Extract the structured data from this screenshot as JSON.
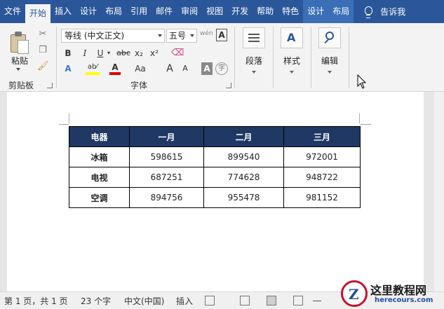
{
  "tabs": [
    {
      "label": "文件",
      "state": "normal"
    },
    {
      "label": "开始",
      "state": "active"
    },
    {
      "label": "插入",
      "state": "normal"
    },
    {
      "label": "设计",
      "state": "normal"
    },
    {
      "label": "布局",
      "state": "normal"
    },
    {
      "label": "引用",
      "state": "normal"
    },
    {
      "label": "邮件",
      "state": "normal"
    },
    {
      "label": "审阅",
      "state": "normal"
    },
    {
      "label": "视图",
      "state": "normal"
    },
    {
      "label": "开发",
      "state": "normal"
    },
    {
      "label": "帮助",
      "state": "normal"
    },
    {
      "label": "特色",
      "state": "normal"
    },
    {
      "label": "设计",
      "state": "contextual"
    },
    {
      "label": "布局",
      "state": "contextual"
    }
  ],
  "tell_me": "告诉我",
  "ribbon": {
    "clipboard": {
      "paste_label": "粘贴",
      "group_label": "剪贴板"
    },
    "font": {
      "font_name": "等线 (中文正文)",
      "font_size": "五号",
      "phonetic_label": "wén",
      "bold": "B",
      "italic": "I",
      "underline": "U",
      "strike": "abc",
      "subscript": "x₂",
      "superscript": "x²",
      "text_effect": "A",
      "highlight": "ab⁄",
      "font_color": "A",
      "change_case": "Aa",
      "grow": "A",
      "shrink": "A",
      "char_shading": "A",
      "enclose": "字",
      "border_char": "A",
      "group_label": "字体"
    },
    "paragraph": {
      "label": "段落"
    },
    "styles": {
      "label": "样式"
    },
    "editing": {
      "label": "编辑"
    }
  },
  "table": {
    "headers": [
      "电器",
      "一月",
      "二月",
      "三月"
    ],
    "rows": [
      [
        "冰箱",
        "598615",
        "899540",
        "972001"
      ],
      [
        "电视",
        "687251",
        "774628",
        "948722"
      ],
      [
        "空调",
        "894756",
        "955478",
        "981152"
      ]
    ],
    "header_color": "#1f3864"
  },
  "status": {
    "page": "第 1 页，共 1 页",
    "words": "23 个字",
    "language": "中文(中国)",
    "mode": "插入"
  },
  "watermark": {
    "title": "这里教程网",
    "url": "herecours.com"
  },
  "colors": {
    "ribbon_tab": "#2b579a",
    "accent_red": "#c8102e",
    "highlight_yellow": "#ffff00",
    "font_red": "#e00000"
  }
}
